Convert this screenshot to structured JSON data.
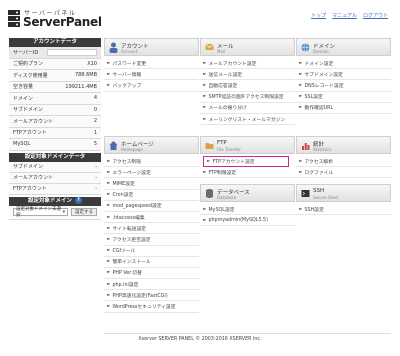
{
  "header": {
    "logo_sub": "サーバーパネル",
    "logo_main": "ServerPanel",
    "links": [
      "トップ",
      "マニュアル",
      "ログアウト"
    ]
  },
  "sidebar": {
    "account_title": "アカウントデータ",
    "account_rows": [
      {
        "label": "サーバーID",
        "value": ""
      },
      {
        "label": "ご契約プラン",
        "value": "X10"
      },
      {
        "label": "ディスク使用量",
        "value": "788.6MB"
      },
      {
        "label": "空き容量",
        "value": "199211.4MB"
      },
      {
        "label": "ドメイン",
        "value": "4"
      },
      {
        "label": "サブドメイン",
        "value": "0"
      },
      {
        "label": "メールアカウント",
        "value": "2"
      },
      {
        "label": "FTPアカウント",
        "value": "1"
      },
      {
        "label": "MySQL",
        "value": "5"
      }
    ],
    "domain_title": "設定対象ドメインデータ",
    "domain_rows": [
      {
        "label": "サブドメイン",
        "value": "-"
      },
      {
        "label": "メールアカウント",
        "value": "-"
      },
      {
        "label": "FTPアカウント",
        "value": "-"
      }
    ],
    "target_title": "設定対象ドメイン",
    "target_badge": "?",
    "select_value": "設定対象ドメイン未選択",
    "select_button": "設定する"
  },
  "panels": {
    "account": {
      "title": "アカウント",
      "sub": "Account",
      "items": [
        "パスワード変更",
        "サーバー情報",
        "バックアップ"
      ]
    },
    "mail": {
      "title": "メール",
      "sub": "Mail",
      "items": [
        "メールアカウント設定",
        "送信メール設定",
        "自動応答設定",
        "SMTP認証の国外アクセス制限設定",
        "メールの振り分け",
        "メーリングリスト・メールマガジン"
      ]
    },
    "domain": {
      "title": "ドメイン",
      "sub": "Domain",
      "items": [
        "ドメイン設定",
        "サブドメイン設定",
        "DNSレコード設定",
        "SSL設定",
        "動作確認URL"
      ]
    },
    "homepage": {
      "title": "ホームページ",
      "sub": "Homepage",
      "items": [
        "アクセス制限",
        "エラーページ設定",
        "MIME設定",
        "Cron設定",
        "mod_pagespeed設定",
        ".htaccess編集",
        "サイト転送設定",
        "アクセス拒否設定",
        "CGIツール",
        "簡単インストール",
        "PHP Ver.切替",
        "php.ini設定",
        "PHP高速化設定(FastCGI)",
        "WordPressセキュリティ設定"
      ]
    },
    "ftp": {
      "title": "FTP",
      "sub": "File Transfer",
      "items": [
        "FTPアカウント設定",
        "FTP制限設定"
      ]
    },
    "stats": {
      "title": "統計",
      "sub": "Statistics",
      "items": [
        "アクセス解析",
        "ログファイル"
      ]
    },
    "database": {
      "title": "データベース",
      "sub": "Database",
      "items": [
        "MySQL設定",
        "phpmyadmin(MySQL5.5)"
      ]
    },
    "ssh": {
      "title": "SSH",
      "sub": "Secure Shell",
      "items": [
        "SSH設定"
      ]
    }
  },
  "footer": "Xserver SERVER PANEL  © 2003-2016 XSERVER Inc.",
  "colors": {
    "highlight": "#d1268a",
    "sidebar_head": "#3b3b3b",
    "link": "#3b6fb6"
  }
}
